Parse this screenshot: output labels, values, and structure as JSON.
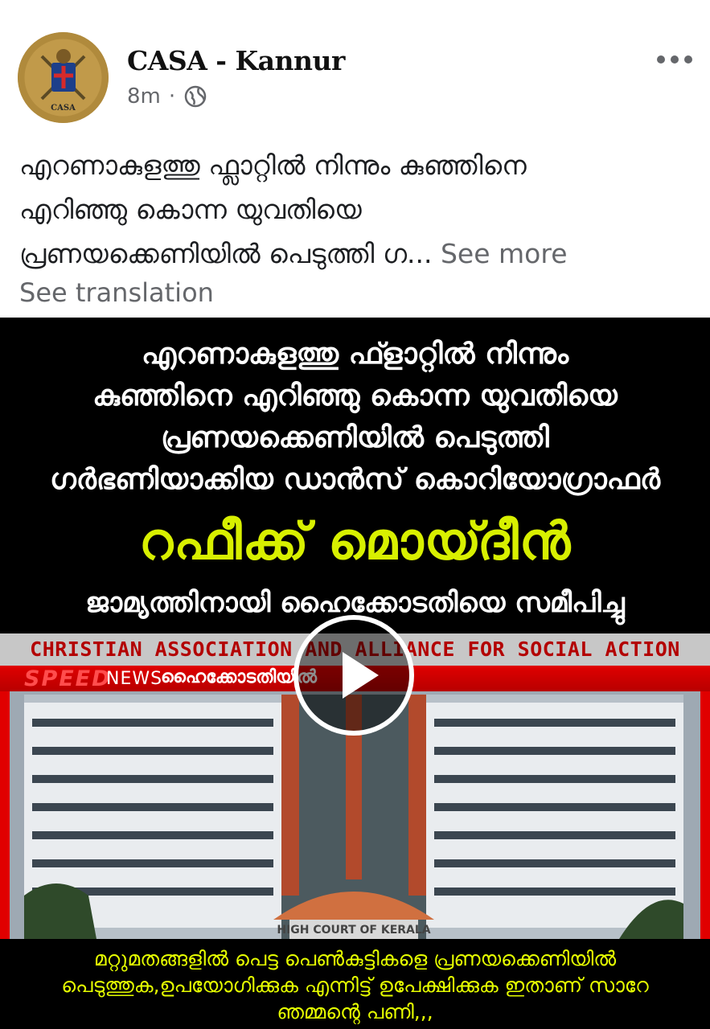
{
  "post": {
    "page_name": "CASA - Kannur",
    "time": "8m",
    "dot": "·",
    "caption_lines": [
      "എറണാകുളത്തു ഫ്ലാറ്റിൽ നിന്നും കുഞ്ഞിനെ",
      "എറിഞ്ഞു കൊന്ന യുവതിയെ",
      "പ്രണയക്കെണിയിൽ പെടുത്തി ഗ..."
    ],
    "see_more": "See more",
    "see_translation": "See translation"
  },
  "video": {
    "headline_lines": [
      "എറണാകുളത്തു ഫ്ളാറ്റിൽ നിന്നും",
      "കുഞ്ഞിനെ എറിഞ്ഞു കൊന്ന യുവതിയെ",
      "പ്രണയക്കെണിയിൽ പെടുത്തി",
      "ഗർഭണിയാക്കിയ ഡാൻസ് കൊറിയോഗ്രാഫർ"
    ],
    "name_line": "റഫീക്ക് മൊയ്ദീൻ",
    "sub_line": "ജാമ്യത്തിനായി ഹൈക്കോടതിയെ സമീപിച്ചു",
    "banner": "CHRISTIAN ASSOCIATION AND ALLIANCE FOR SOCIAL ACTION",
    "channel_speed": "SPEED",
    "channel_news": "NEWS",
    "channel_topic": "ഹൈക്കോടതിയിൽ",
    "building_sign": "HIGH COURT OF KERALA",
    "footer_lines": [
      "മറ്റുമതങ്ങളിൽ പെട്ട പെൺകുട്ടികളെ പ്രണയക്കെണിയിൽ",
      "പെടുത്തുക,ഉപയോഗിക്കുക എന്നിട്ട് ഉപേക്ഷിക്കുക ഇതാണ് സാറേ",
      "ഞമ്മന്റെ പണി,,,"
    ],
    "logo_text": "CASA"
  },
  "colors": {
    "headline_accent": "#d8f000",
    "banner_text": "#b30000",
    "news_red": "#e00000",
    "meta_gray": "#65676b"
  },
  "icons": {
    "globe": "globe-icon",
    "more": "more-options-icon",
    "play": "play-icon"
  }
}
